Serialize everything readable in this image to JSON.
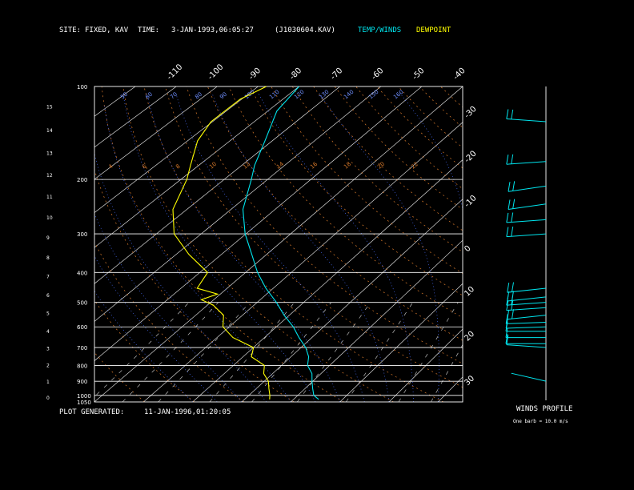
{
  "header": {
    "site_label": "SITE:",
    "site_value": "FIXED, KAV",
    "time_label": "TIME:",
    "time_value": "3-JAN-1993,06:05:27",
    "file_value": "(J1030604.KAV)",
    "legend_temp": "TEMP/WINDS",
    "legend_dew": "DEWPOINT",
    "temp_color": "#00e5ee",
    "dew_color": "#ffff00"
  },
  "footer": {
    "generated_label": "PLOT GENERATED:",
    "generated_value": "11-JAN-1996,01:20:05",
    "winds_title": "WINDS PROFILE",
    "barb_note": "One barb = 10.0 m/s"
  },
  "chart_data": {
    "type": "line",
    "diagram": "skew-T log-p",
    "pressure_levels": [
      100,
      200,
      300,
      400,
      500,
      600,
      700,
      800,
      900,
      1000,
      1050
    ],
    "pressure_range_mb": [
      100,
      1050
    ],
    "temperature_tick_labels": [
      -110,
      -100,
      -90,
      -80,
      -70,
      -60,
      -50,
      -40
    ],
    "temperature_range_top_C": [
      -130,
      -40
    ],
    "temperature_range_bottom_C": [
      -40,
      35
    ],
    "right_axis_labels": [
      -30,
      -20,
      -10,
      0,
      10,
      20,
      30
    ],
    "height_labels_km": [
      0,
      1,
      2,
      3,
      4,
      5,
      6,
      7,
      8,
      9,
      10,
      11,
      12,
      13,
      14,
      15
    ],
    "potential_temperature_labels": [
      "",
      "50",
      "60",
      "70",
      "80",
      "90",
      "100",
      "110",
      "120",
      "130",
      "140",
      "150",
      "160"
    ],
    "mixing_ratio_labels": [
      "4",
      "6",
      "8",
      "10",
      "12",
      "14",
      "16",
      "18",
      "20",
      "22"
    ],
    "series": [
      {
        "key": "temperature",
        "color": "#00e5ee",
        "points": [
          {
            "p": 100,
            "t": -80
          },
          {
            "p": 120,
            "t": -79
          },
          {
            "p": 150,
            "t": -74
          },
          {
            "p": 180,
            "t": -70
          },
          {
            "p": 200,
            "t": -67
          },
          {
            "p": 250,
            "t": -61
          },
          {
            "p": 300,
            "t": -54
          },
          {
            "p": 350,
            "t": -47
          },
          {
            "p": 400,
            "t": -41
          },
          {
            "p": 450,
            "t": -35
          },
          {
            "p": 500,
            "t": -29
          },
          {
            "p": 550,
            "t": -24
          },
          {
            "p": 600,
            "t": -19
          },
          {
            "p": 650,
            "t": -15
          },
          {
            "p": 700,
            "t": -11
          },
          {
            "p": 750,
            "t": -8
          },
          {
            "p": 800,
            "t": -6
          },
          {
            "p": 850,
            "t": -3
          },
          {
            "p": 900,
            "t": -1
          },
          {
            "p": 950,
            "t": 1
          },
          {
            "p": 1000,
            "t": 3
          },
          {
            "p": 1030,
            "t": 5
          }
        ]
      },
      {
        "key": "dewpoint",
        "color": "#ffff00",
        "points": [
          {
            "p": 100,
            "t": -88
          },
          {
            "p": 110,
            "t": -91
          },
          {
            "p": 130,
            "t": -92
          },
          {
            "p": 150,
            "t": -90
          },
          {
            "p": 180,
            "t": -85
          },
          {
            "p": 200,
            "t": -82
          },
          {
            "p": 250,
            "t": -77
          },
          {
            "p": 300,
            "t": -70
          },
          {
            "p": 350,
            "t": -61
          },
          {
            "p": 400,
            "t": -52
          },
          {
            "p": 450,
            "t": -50
          },
          {
            "p": 470,
            "t": -44
          },
          {
            "p": 490,
            "t": -46
          },
          {
            "p": 510,
            "t": -42
          },
          {
            "p": 550,
            "t": -37
          },
          {
            "p": 600,
            "t": -34
          },
          {
            "p": 650,
            "t": -29
          },
          {
            "p": 700,
            "t": -22
          },
          {
            "p": 750,
            "t": -20
          },
          {
            "p": 800,
            "t": -15
          },
          {
            "p": 850,
            "t": -13
          },
          {
            "p": 900,
            "t": -10
          },
          {
            "p": 950,
            "t": -8
          },
          {
            "p": 1000,
            "t": -6
          },
          {
            "p": 1030,
            "t": -5
          }
        ]
      }
    ],
    "wind_profile": [
      {
        "p": 130,
        "dir": 280,
        "speed": 25
      },
      {
        "p": 175,
        "dir": 260,
        "speed": 22
      },
      {
        "p": 210,
        "dir": 250,
        "speed": 20
      },
      {
        "p": 240,
        "dir": 250,
        "speed": 20
      },
      {
        "p": 270,
        "dir": 260,
        "speed": 22
      },
      {
        "p": 300,
        "dir": 260,
        "speed": 25
      },
      {
        "p": 450,
        "dir": 255,
        "speed": 25
      },
      {
        "p": 480,
        "dir": 255,
        "speed": 22
      },
      {
        "p": 500,
        "dir": 260,
        "speed": 20
      },
      {
        "p": 520,
        "dir": 260,
        "speed": 22
      },
      {
        "p": 550,
        "dir": 255,
        "speed": 20
      },
      {
        "p": 580,
        "dir": 265,
        "speed": 18
      },
      {
        "p": 600,
        "dir": 265,
        "speed": 18
      },
      {
        "p": 620,
        "dir": 270,
        "speed": 15
      },
      {
        "p": 650,
        "dir": 270,
        "speed": 15
      },
      {
        "p": 680,
        "dir": 270,
        "speed": 12
      },
      {
        "p": 700,
        "dir": 280,
        "speed": 10
      },
      {
        "p": 900,
        "dir": 300,
        "speed": 5
      }
    ]
  }
}
